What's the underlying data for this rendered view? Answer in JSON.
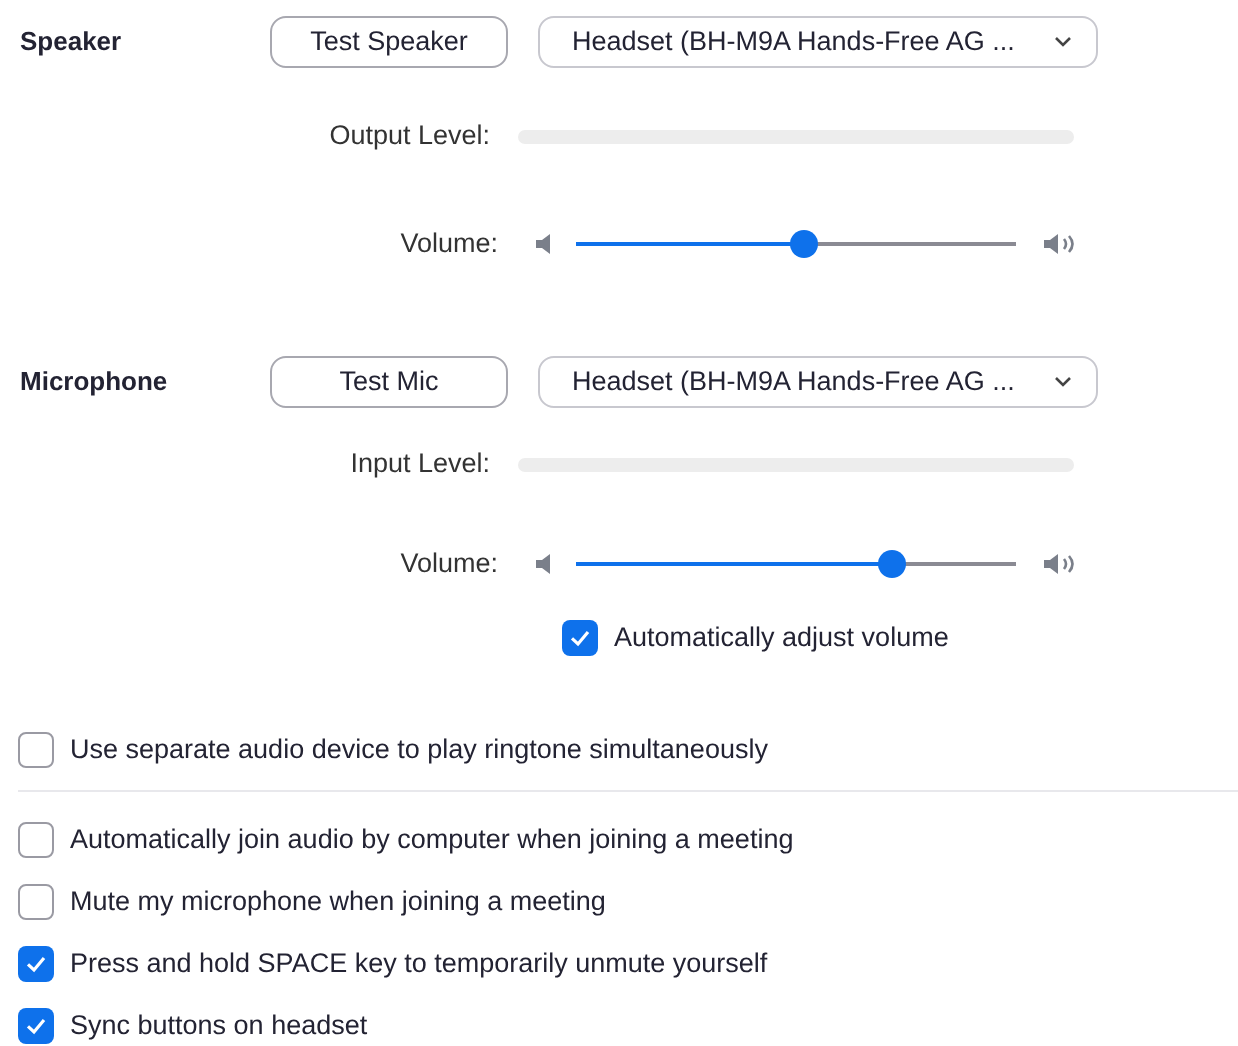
{
  "devices": [
    {
      "label": "Speaker",
      "test_button": "Test Speaker",
      "device": "Headset (BH-M9A Hands-Free AG ...",
      "level_label": "Output Level:",
      "level": 0,
      "volume_label": "Volume:",
      "volume": {
        "level": 0.52
      }
    },
    {
      "label": "Microphone",
      "test_button": "Test Mic",
      "device": "Headset (BH-M9A Hands-Free AG ...",
      "level_label": "Input Level:",
      "level": 0,
      "volume_label": "Volume:",
      "volume": {
        "level": 0.72
      },
      "auto_adjust": {
        "label": "Automatically adjust volume",
        "checked": true
      }
    }
  ],
  "separate_ringtone": {
    "label": "Use separate audio device to play ringtone simultaneously",
    "checked": false
  },
  "options": [
    {
      "label": "Automatically join audio by computer when joining a meeting",
      "checked": false
    },
    {
      "label": "Mute my microphone when joining a meeting",
      "checked": false
    },
    {
      "label": "Press and hold SPACE key to temporarily unmute yourself",
      "checked": true
    },
    {
      "label": "Sync buttons on headset",
      "checked": true
    }
  ]
}
